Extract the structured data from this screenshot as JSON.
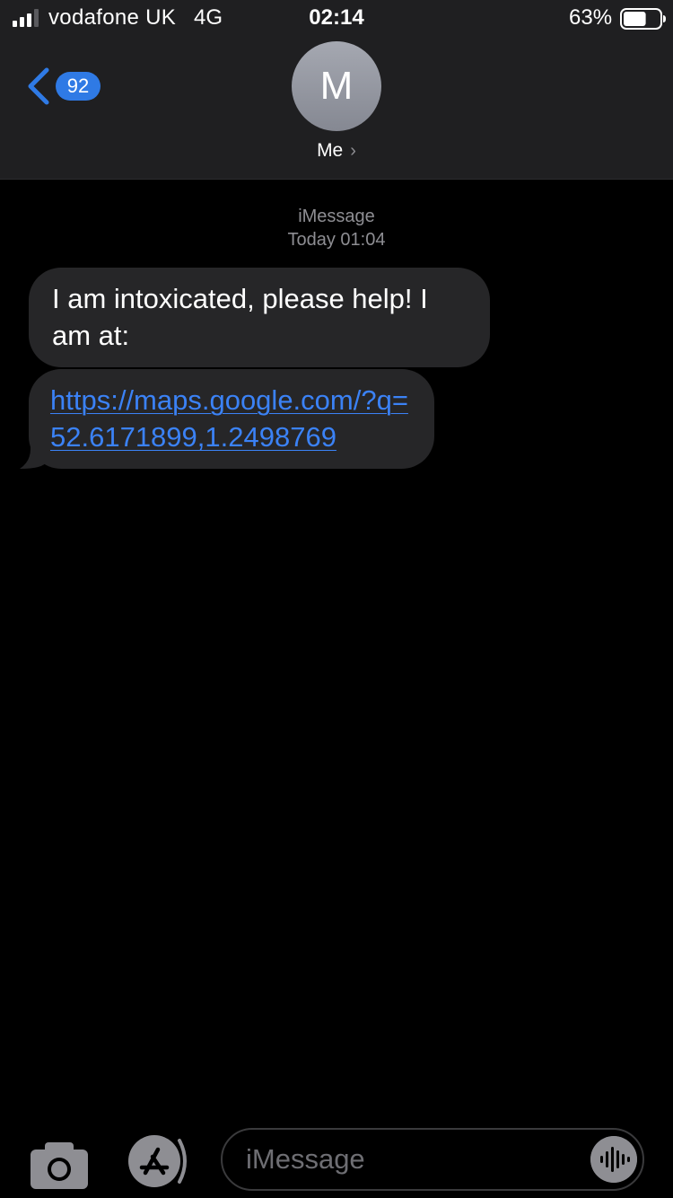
{
  "status_bar": {
    "carrier": "vodafone UK",
    "network": "4G",
    "time": "02:14",
    "battery_percent": "63%",
    "battery_level": 0.63
  },
  "header": {
    "back_badge_count": "92",
    "contact_initial": "M",
    "contact_name": "Me",
    "contact_chevron": "›"
  },
  "conversation": {
    "service": "iMessage",
    "timestamp": "Today 01:04",
    "messages": [
      {
        "text": "I am intoxicated, please help! I am at:"
      },
      {
        "link_text": "https://maps.google.com/?q=52.6171899,1.2498769"
      }
    ]
  },
  "input_bar": {
    "placeholder": "iMessage"
  },
  "colors": {
    "accent_blue": "#2f7ae5",
    "link_blue": "#3b82f6",
    "bubble_gray": "#262628",
    "header_bg": "#1f1f21",
    "meta_text": "#8e8e93"
  },
  "icons": {
    "signal": "signal-bars-icon",
    "battery": "battery-icon",
    "back": "chevron-left-icon",
    "camera": "camera-icon",
    "appstore": "app-store-icon",
    "audio": "audio-waveform-icon"
  }
}
